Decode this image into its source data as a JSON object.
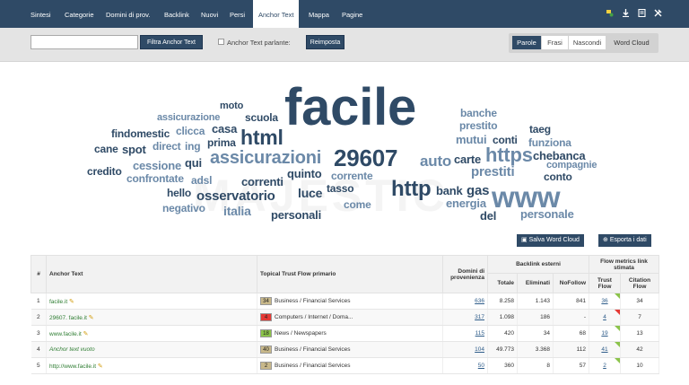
{
  "nav": {
    "tabs": [
      "Sintesi",
      "Categorie",
      "Domini di prov.",
      "Backlink",
      "Nuovi",
      "Persi",
      "Anchor Text",
      "Mappa",
      "Pagine"
    ],
    "active": "Anchor Text",
    "icons": [
      "flag-add-icon",
      "download-icon",
      "report-icon",
      "tools-icon"
    ]
  },
  "filter": {
    "input_value": "",
    "filter_button": "Filtra Anchor Text",
    "checkbox_label": "Anchor Text parlante:",
    "reset_button": "Reimposta",
    "view_options": [
      "Parole",
      "Frasi",
      "Nascondi",
      "Word Cloud"
    ],
    "view_active": "Parole"
  },
  "cloud": {
    "watermark": "MAJESTIC",
    "words": [
      {
        "t": "facile",
        "c": "#2f4a66"
      },
      {
        "t": "html",
        "c": "#2f4a66"
      },
      {
        "t": "assicurazioni",
        "c": "#6b89a8"
      },
      {
        "t": "29607",
        "c": "#2f4a66"
      },
      {
        "t": "https",
        "c": "#6b89a8"
      },
      {
        "t": "www",
        "c": "#6b89a8"
      },
      {
        "t": "http",
        "c": "#2f4a66"
      },
      {
        "t": "auto",
        "c": "#6b89a8"
      },
      {
        "t": "prestiti",
        "c": "#6b89a8"
      },
      {
        "t": "osservatorio",
        "c": "#2f4a66"
      },
      {
        "t": "moto",
        "c": "#2f4a66"
      },
      {
        "t": "assicurazione",
        "c": "#6b89a8"
      },
      {
        "t": "scuola",
        "c": "#2f4a66"
      },
      {
        "t": "findomestic",
        "c": "#2f4a66"
      },
      {
        "t": "clicca",
        "c": "#6b89a8"
      },
      {
        "t": "casa",
        "c": "#2f4a66"
      },
      {
        "t": "cane",
        "c": "#2f4a66"
      },
      {
        "t": "spot",
        "c": "#2f4a66"
      },
      {
        "t": "direct",
        "c": "#6b89a8"
      },
      {
        "t": "ing",
        "c": "#6b89a8"
      },
      {
        "t": "prima",
        "c": "#2f4a66"
      },
      {
        "t": "credito",
        "c": "#2f4a66"
      },
      {
        "t": "cessione",
        "c": "#6b89a8"
      },
      {
        "t": "qui",
        "c": "#2f4a66"
      },
      {
        "t": "confrontate",
        "c": "#6b89a8"
      },
      {
        "t": "adsl",
        "c": "#6b89a8"
      },
      {
        "t": "correnti",
        "c": "#2f4a66"
      },
      {
        "t": "quinto",
        "c": "#2f4a66"
      },
      {
        "t": "corrente",
        "c": "#6b89a8"
      },
      {
        "t": "hello",
        "c": "#2f4a66"
      },
      {
        "t": "luce",
        "c": "#2f4a66"
      },
      {
        "t": "tasso",
        "c": "#2f4a66"
      },
      {
        "t": "negativo",
        "c": "#6b89a8"
      },
      {
        "t": "italia",
        "c": "#6b89a8"
      },
      {
        "t": "personali",
        "c": "#2f4a66"
      },
      {
        "t": "come",
        "c": "#6b89a8"
      },
      {
        "t": "banche",
        "c": "#6b89a8"
      },
      {
        "t": "prestito",
        "c": "#6b89a8"
      },
      {
        "t": "mutui",
        "c": "#6b89a8"
      },
      {
        "t": "conti",
        "c": "#2f4a66"
      },
      {
        "t": "taeg",
        "c": "#2f4a66"
      },
      {
        "t": "funziona",
        "c": "#6b89a8"
      },
      {
        "t": "carte",
        "c": "#2f4a66"
      },
      {
        "t": "chebanca",
        "c": "#2f4a66"
      },
      {
        "t": "compagnie",
        "c": "#6b89a8"
      },
      {
        "t": "conto",
        "c": "#2f4a66"
      },
      {
        "t": "bank",
        "c": "#2f4a66"
      },
      {
        "t": "gas",
        "c": "#2f4a66"
      },
      {
        "t": "energia",
        "c": "#6b89a8"
      },
      {
        "t": "del",
        "c": "#2f4a66"
      },
      {
        "t": "personale",
        "c": "#6b89a8"
      }
    ],
    "save_button": "Salva Word Cloud",
    "export_button": "Esporta i dati"
  },
  "table": {
    "headers": {
      "num": "#",
      "anchor": "Anchor Text",
      "topical": "Topical Trust Flow primario",
      "domains": "Domini di provenienza",
      "backlinks_group": "Backlink esterni",
      "total": "Totale",
      "deleted": "Eliminati",
      "nofollow": "NoFollow",
      "flow_group": "Flow metrics link stimata",
      "trust_flow": "Trust Flow",
      "citation_flow": "Citation Flow"
    },
    "rows": [
      {
        "n": "1",
        "anchor": "facile.it",
        "pen": true,
        "italic": false,
        "badge": "34",
        "badge_color": "#c8b88a",
        "topic": "Business / Financial Services",
        "domains": "636",
        "total": "8.258",
        "deleted": "1.143",
        "nofollow": "841",
        "tf": "36",
        "cf": "34",
        "flag": "g"
      },
      {
        "n": "2",
        "anchor": "29607. facile.it",
        "pen": true,
        "italic": false,
        "badge": "4",
        "badge_color": "#e53935",
        "topic": "Computers / Internet / Doma...",
        "domains": "317",
        "total": "1.098",
        "deleted": "186",
        "nofollow": "-",
        "tf": "4",
        "cf": "7",
        "flag": "r"
      },
      {
        "n": "3",
        "anchor": "www.facile.it",
        "pen": true,
        "italic": false,
        "badge": "18",
        "badge_color": "#8bc34a",
        "topic": "News / Newspapers",
        "domains": "115",
        "total": "420",
        "deleted": "34",
        "nofollow": "68",
        "tf": "19",
        "cf": "13",
        "flag": "g"
      },
      {
        "n": "4",
        "anchor": "Anchor text vuoto",
        "pen": false,
        "italic": true,
        "badge": "40",
        "badge_color": "#c8b88a",
        "topic": "Business / Financial Services",
        "domains": "104",
        "total": "49.773",
        "deleted": "3.368",
        "nofollow": "112",
        "tf": "41",
        "cf": "42",
        "flag": "g"
      },
      {
        "n": "5",
        "anchor": "http://www.facile.it",
        "pen": true,
        "italic": false,
        "badge": "2",
        "badge_color": "#c8b88a",
        "topic": "Business / Financial Services",
        "domains": "50",
        "total": "360",
        "deleted": "8",
        "nofollow": "57",
        "tf": "2",
        "cf": "10",
        "flag": "g"
      }
    ]
  }
}
